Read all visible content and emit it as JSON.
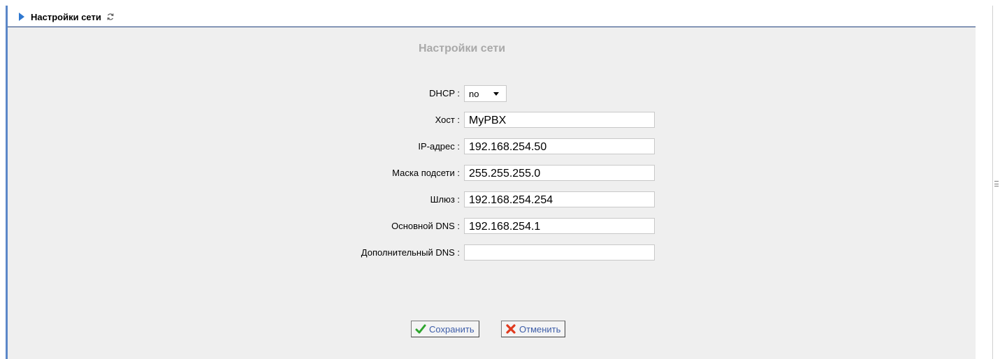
{
  "header": {
    "title": "Настройки сети"
  },
  "form": {
    "title": "Настройки сети",
    "dhcp": {
      "label": "DHCP :",
      "value": "no"
    },
    "host": {
      "label": "Хост :",
      "value": "MyPBX"
    },
    "ip": {
      "label": "IP-адрес :",
      "value": "192.168.254.50"
    },
    "mask": {
      "label": "Маска подсети :",
      "value": "255.255.255.0"
    },
    "gateway": {
      "label": "Шлюз :",
      "value": "192.168.254.254"
    },
    "dns1": {
      "label": "Основной DNS :",
      "value": "192.168.254.1"
    },
    "dns2": {
      "label": "Дополнительный DNS :",
      "value": ""
    }
  },
  "buttons": {
    "save": "Сохранить",
    "cancel": "Отменить"
  },
  "colors": {
    "accent": "#2f78d0",
    "header_line": "#1f3f7a",
    "panel_bg": "#efefef",
    "title_gray": "#a9a9a9",
    "button_text": "#3d5da8"
  },
  "icons": {
    "header_arrow": "triangle-right-icon",
    "refresh": "refresh-icon",
    "save": "checkmark-icon",
    "cancel": "x-icon"
  }
}
